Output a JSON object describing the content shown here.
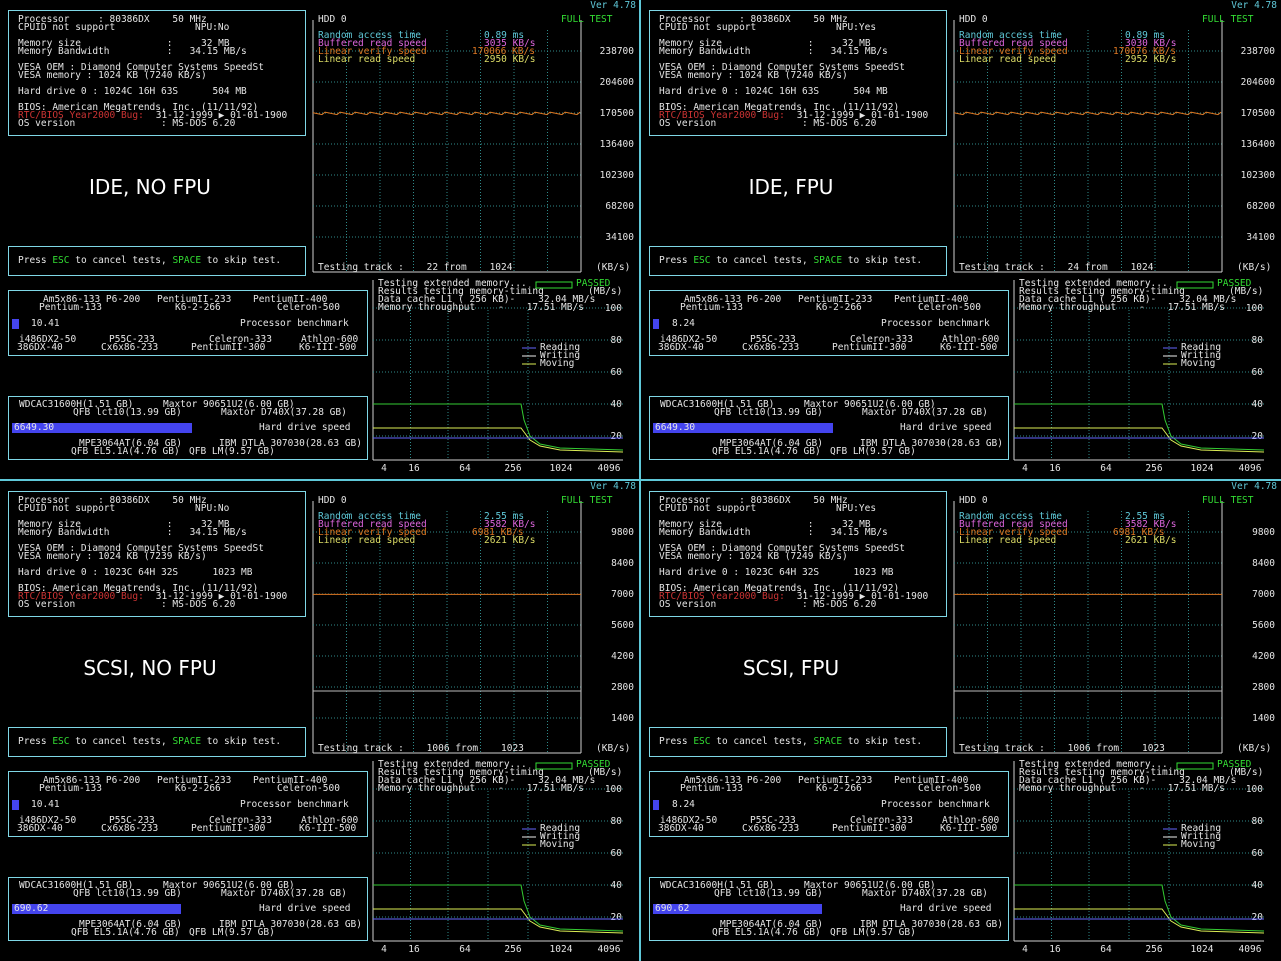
{
  "version": "Ver 4.78",
  "common": {
    "processor_label": "Processor     : 80386DX    50 MHz",
    "cpuid": "CPUID not support",
    "memsize": "Memory size               :     32 MB",
    "membw": "Memory Bandwidth          :   34.15 MB/s",
    "vesa_oem": "VESA OEM : Diamond Computer Systems SpeedSt",
    "bios": "BIOS: American Megatrends, Inc. (11/11/92)",
    "y2k_label": "RTC/BIOS Year2000 Bug:",
    "y2k_value": " 31-12-1999 ▶ 01-01-1900",
    "os": "OS version               : MS-DOS 6.20",
    "press_esc": "ESC",
    "press_space": "SPACE",
    "press_a": "Press ",
    "press_b": " to cancel tests, ",
    "press_c": " to skip test.",
    "hdd": "HDD 0",
    "full_test": "FULL TEST",
    "kbs_unit": "(KB/s)",
    "mbs_unit": "(MB/s)",
    "passed": "PASSED",
    "testing_ext": "Testing extended memory...",
    "results_timing": "Results testing memory-timing",
    "data_cache": "Data cache L1 ( 256 KB)-    32.04 MB/s",
    "mem_throughput": "Memory throughput    -    17.51 MB/s",
    "legend_reading": "Reading",
    "legend_writing": "Writing",
    "legend_moving": "Moving",
    "proc_bench": "Processor benchmark",
    "hdd_speed": "Hard drive speed",
    "cpu_top1": "Am5x86-133 P6-200",
    "cpu_top2": "PentiumII-233",
    "cpu_top3": "PentiumII-400",
    "cpu_mid1": "Pentium-133",
    "cpu_mid2": "K6-2-266",
    "cpu_mid3": "Celeron-500",
    "cpu_bot1": "i486DX2-50",
    "cpu_bot2": "P55C-233",
    "cpu_bot3": "Celeron-333",
    "cpu_bot4": "Athlon-600",
    "cpu_bot5": "386DX-40",
    "cpu_bot6": "Cx6x86-233",
    "cpu_bot7": "PentiumII-300",
    "cpu_bot8": "K6-III-500",
    "hd_top1": "WDCAC31600H(1.51 GB)",
    "hd_top2": "Maxtor 90651U2(6.00 GB)",
    "hd_mid1": "QFB lct10(13.99 GB)",
    "hd_mid2": "Maxtor D740X(37.28 GB)",
    "hd_bot1": "MPE3064AT(6.04 GB)",
    "hd_bot2": "IBM DTLA 307030(28.63 GB)",
    "hd_bot3": "QFB EL5.1A(4.76 GB)",
    "hd_bot4": "QFB LM(9.57 GB)",
    "mem_ticks": [
      "100",
      "80",
      "60",
      "40",
      "20"
    ],
    "mem_xticks": [
      "4",
      "16",
      "64",
      "256",
      "1024",
      "4096"
    ]
  },
  "quads": [
    {
      "label": "IDE, NO FPU",
      "npu": "NPU:No",
      "vesa_mem": "VESA memory : 1024 KB (7240 KB/s)",
      "hdd_geom": "Hard drive 0 : 1024C 16H 63S      504 MB",
      "rat_label": "Random access time",
      "rat": "0.89 ms",
      "brs_label": "Buffered read speed",
      "brs": "3035 KB/s",
      "lvs_label": "Linear verify speed",
      "lvs": "170066 KB/s",
      "lrs_label": "Linear read speed",
      "lrs": "2950 KB/s",
      "yticks": [
        "238700",
        "204600",
        "170500",
        "136400",
        "102300",
        "68200",
        "34100"
      ],
      "track": "Testing track :    22 from    1024",
      "cpu_score": "10.41",
      "cpu_fill": 0.02,
      "hd_score": "6649.30",
      "hd_fill": 0.51
    },
    {
      "label": "IDE, FPU",
      "npu": "NPU:Yes",
      "vesa_mem": "VESA memory : 1024 KB (7240 KB/s)",
      "hdd_geom": "Hard drive 0 : 1024C 16H 63S      504 MB",
      "rat_label": "Random access time",
      "rat": "0.89 ms",
      "brs_label": "Buffered read speed",
      "brs": "3030 KB/s",
      "lvs_label": "Linear verify speed",
      "lvs": "170076 KB/s",
      "lrs_label": "Linear read speed",
      "lrs": "2952 KB/s",
      "yticks": [
        "238700",
        "204600",
        "170500",
        "136400",
        "102300",
        "68200",
        "34100"
      ],
      "track": "Testing track :    24 from    1024",
      "cpu_score": "8.24",
      "cpu_fill": 0.016,
      "hd_score": "6649.30",
      "hd_fill": 0.51
    },
    {
      "label": "SCSI, NO FPU",
      "npu": "NPU:No",
      "vesa_mem": "VESA memory : 1024 KB (7239 KB/s)",
      "hdd_geom": "Hard drive 0 : 1023C 64H 32S      1023 MB",
      "rat_label": "Random access time",
      "rat": "2.55 ms",
      "brs_label": "Buffered read speed",
      "brs": "3582 KB/s",
      "lvs_label": "Linear verify speed",
      "lvs": "6981 KB/s",
      "lrs_label": "Linear read speed",
      "lrs": "2621 KB/s",
      "yticks": [
        "9800",
        "8400",
        "7000",
        "5600",
        "4200",
        "2800",
        "1400"
      ],
      "track": "Testing track :    1006 from    1023",
      "cpu_score": "10.41",
      "cpu_fill": 0.02,
      "hd_score": "690.62",
      "hd_fill": 0.48
    },
    {
      "label": "SCSI, FPU",
      "npu": "NPU:Yes",
      "vesa_mem": "VESA memory : 1024 KB (7249 KB/s)",
      "hdd_geom": "Hard drive 0 : 1023C 64H 32S      1023 MB",
      "rat_label": "Random access time",
      "rat": "2.55 ms",
      "brs_label": "Buffered read speed",
      "brs": "3582 KB/s",
      "lvs_label": "Linear verify speed",
      "lvs": "6981 KB/s",
      "lrs_label": "Linear read speed",
      "lrs": "2621 KB/s",
      "yticks": [
        "9800",
        "8400",
        "7000",
        "5600",
        "4200",
        "2800",
        "1400"
      ],
      "track": "Testing track :    1006 from    1023",
      "cpu_score": "8.24",
      "cpu_fill": 0.016,
      "hd_score": "690.62",
      "hd_fill": 0.48
    }
  ],
  "chart_data": [
    {
      "type": "line",
      "title": "HDD 0",
      "ylabel": "(KB/s)",
      "series": [
        {
          "name": "Linear verify speed",
          "values": [
            170066,
            170066
          ]
        }
      ],
      "ylim": [
        0,
        272800
      ]
    },
    {
      "type": "line",
      "title": "HDD 0",
      "ylabel": "(KB/s)",
      "series": [
        {
          "name": "Linear verify speed",
          "values": [
            170076,
            170076
          ]
        }
      ],
      "ylim": [
        0,
        272800
      ]
    },
    {
      "type": "line",
      "title": "HDD 0",
      "ylabel": "(KB/s)",
      "series": [
        {
          "name": "Linear verify speed",
          "values": [
            6981,
            6981
          ]
        }
      ],
      "ylim": [
        0,
        11200
      ]
    },
    {
      "type": "line",
      "title": "HDD 0",
      "ylabel": "(KB/s)",
      "series": [
        {
          "name": "Linear verify speed",
          "values": [
            6981,
            6981
          ]
        }
      ],
      "ylim": [
        0,
        11200
      ]
    }
  ]
}
